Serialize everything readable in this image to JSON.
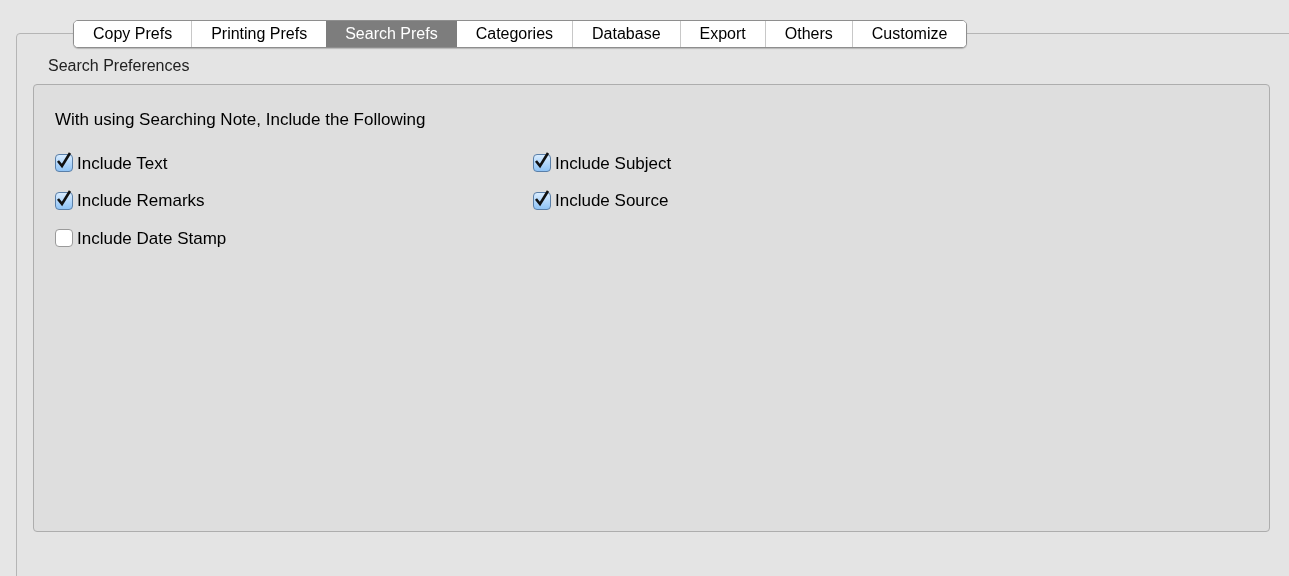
{
  "tabs": [
    {
      "label": "Copy Prefs",
      "selected": false
    },
    {
      "label": "Printing Prefs",
      "selected": false
    },
    {
      "label": "Search Prefs",
      "selected": true
    },
    {
      "label": "Categories",
      "selected": false
    },
    {
      "label": "Database",
      "selected": false
    },
    {
      "label": "Export",
      "selected": false
    },
    {
      "label": "Others",
      "selected": false
    },
    {
      "label": "Customize",
      "selected": false
    }
  ],
  "group_title": "Search Preferences",
  "heading": "With using Searching Note, Include the Following",
  "options": [
    {
      "label": "Include Text",
      "checked": true
    },
    {
      "label": "Include Subject",
      "checked": true
    },
    {
      "label": "Include Remarks",
      "checked": true
    },
    {
      "label": "Include Source",
      "checked": true
    },
    {
      "label": "Include Date Stamp",
      "checked": false
    }
  ]
}
